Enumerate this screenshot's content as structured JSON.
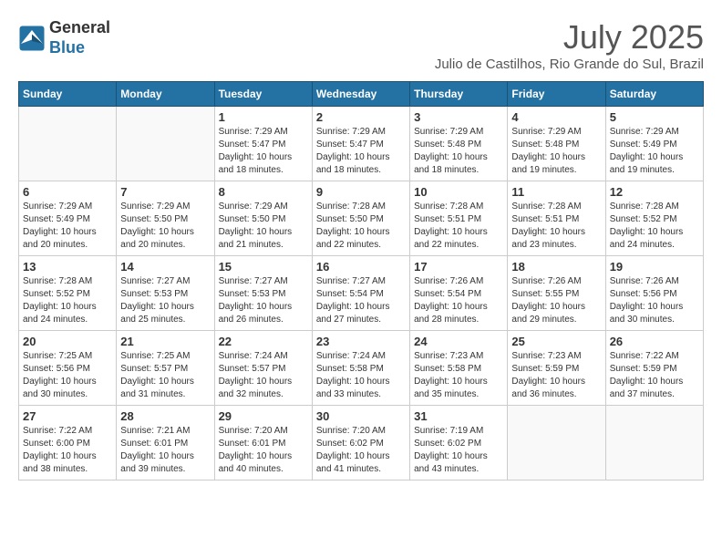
{
  "header": {
    "logo_line1": "General",
    "logo_line2": "Blue",
    "month": "July 2025",
    "location": "Julio de Castilhos, Rio Grande do Sul, Brazil"
  },
  "weekdays": [
    "Sunday",
    "Monday",
    "Tuesday",
    "Wednesday",
    "Thursday",
    "Friday",
    "Saturday"
  ],
  "weeks": [
    [
      {
        "day": "",
        "info": ""
      },
      {
        "day": "",
        "info": ""
      },
      {
        "day": "1",
        "info": "Sunrise: 7:29 AM\nSunset: 5:47 PM\nDaylight: 10 hours and 18 minutes."
      },
      {
        "day": "2",
        "info": "Sunrise: 7:29 AM\nSunset: 5:47 PM\nDaylight: 10 hours and 18 minutes."
      },
      {
        "day": "3",
        "info": "Sunrise: 7:29 AM\nSunset: 5:48 PM\nDaylight: 10 hours and 18 minutes."
      },
      {
        "day": "4",
        "info": "Sunrise: 7:29 AM\nSunset: 5:48 PM\nDaylight: 10 hours and 19 minutes."
      },
      {
        "day": "5",
        "info": "Sunrise: 7:29 AM\nSunset: 5:49 PM\nDaylight: 10 hours and 19 minutes."
      }
    ],
    [
      {
        "day": "6",
        "info": "Sunrise: 7:29 AM\nSunset: 5:49 PM\nDaylight: 10 hours and 20 minutes."
      },
      {
        "day": "7",
        "info": "Sunrise: 7:29 AM\nSunset: 5:50 PM\nDaylight: 10 hours and 20 minutes."
      },
      {
        "day": "8",
        "info": "Sunrise: 7:29 AM\nSunset: 5:50 PM\nDaylight: 10 hours and 21 minutes."
      },
      {
        "day": "9",
        "info": "Sunrise: 7:28 AM\nSunset: 5:50 PM\nDaylight: 10 hours and 22 minutes."
      },
      {
        "day": "10",
        "info": "Sunrise: 7:28 AM\nSunset: 5:51 PM\nDaylight: 10 hours and 22 minutes."
      },
      {
        "day": "11",
        "info": "Sunrise: 7:28 AM\nSunset: 5:51 PM\nDaylight: 10 hours and 23 minutes."
      },
      {
        "day": "12",
        "info": "Sunrise: 7:28 AM\nSunset: 5:52 PM\nDaylight: 10 hours and 24 minutes."
      }
    ],
    [
      {
        "day": "13",
        "info": "Sunrise: 7:28 AM\nSunset: 5:52 PM\nDaylight: 10 hours and 24 minutes."
      },
      {
        "day": "14",
        "info": "Sunrise: 7:27 AM\nSunset: 5:53 PM\nDaylight: 10 hours and 25 minutes."
      },
      {
        "day": "15",
        "info": "Sunrise: 7:27 AM\nSunset: 5:53 PM\nDaylight: 10 hours and 26 minutes."
      },
      {
        "day": "16",
        "info": "Sunrise: 7:27 AM\nSunset: 5:54 PM\nDaylight: 10 hours and 27 minutes."
      },
      {
        "day": "17",
        "info": "Sunrise: 7:26 AM\nSunset: 5:54 PM\nDaylight: 10 hours and 28 minutes."
      },
      {
        "day": "18",
        "info": "Sunrise: 7:26 AM\nSunset: 5:55 PM\nDaylight: 10 hours and 29 minutes."
      },
      {
        "day": "19",
        "info": "Sunrise: 7:26 AM\nSunset: 5:56 PM\nDaylight: 10 hours and 30 minutes."
      }
    ],
    [
      {
        "day": "20",
        "info": "Sunrise: 7:25 AM\nSunset: 5:56 PM\nDaylight: 10 hours and 30 minutes."
      },
      {
        "day": "21",
        "info": "Sunrise: 7:25 AM\nSunset: 5:57 PM\nDaylight: 10 hours and 31 minutes."
      },
      {
        "day": "22",
        "info": "Sunrise: 7:24 AM\nSunset: 5:57 PM\nDaylight: 10 hours and 32 minutes."
      },
      {
        "day": "23",
        "info": "Sunrise: 7:24 AM\nSunset: 5:58 PM\nDaylight: 10 hours and 33 minutes."
      },
      {
        "day": "24",
        "info": "Sunrise: 7:23 AM\nSunset: 5:58 PM\nDaylight: 10 hours and 35 minutes."
      },
      {
        "day": "25",
        "info": "Sunrise: 7:23 AM\nSunset: 5:59 PM\nDaylight: 10 hours and 36 minutes."
      },
      {
        "day": "26",
        "info": "Sunrise: 7:22 AM\nSunset: 5:59 PM\nDaylight: 10 hours and 37 minutes."
      }
    ],
    [
      {
        "day": "27",
        "info": "Sunrise: 7:22 AM\nSunset: 6:00 PM\nDaylight: 10 hours and 38 minutes."
      },
      {
        "day": "28",
        "info": "Sunrise: 7:21 AM\nSunset: 6:01 PM\nDaylight: 10 hours and 39 minutes."
      },
      {
        "day": "29",
        "info": "Sunrise: 7:20 AM\nSunset: 6:01 PM\nDaylight: 10 hours and 40 minutes."
      },
      {
        "day": "30",
        "info": "Sunrise: 7:20 AM\nSunset: 6:02 PM\nDaylight: 10 hours and 41 minutes."
      },
      {
        "day": "31",
        "info": "Sunrise: 7:19 AM\nSunset: 6:02 PM\nDaylight: 10 hours and 43 minutes."
      },
      {
        "day": "",
        "info": ""
      },
      {
        "day": "",
        "info": ""
      }
    ]
  ]
}
